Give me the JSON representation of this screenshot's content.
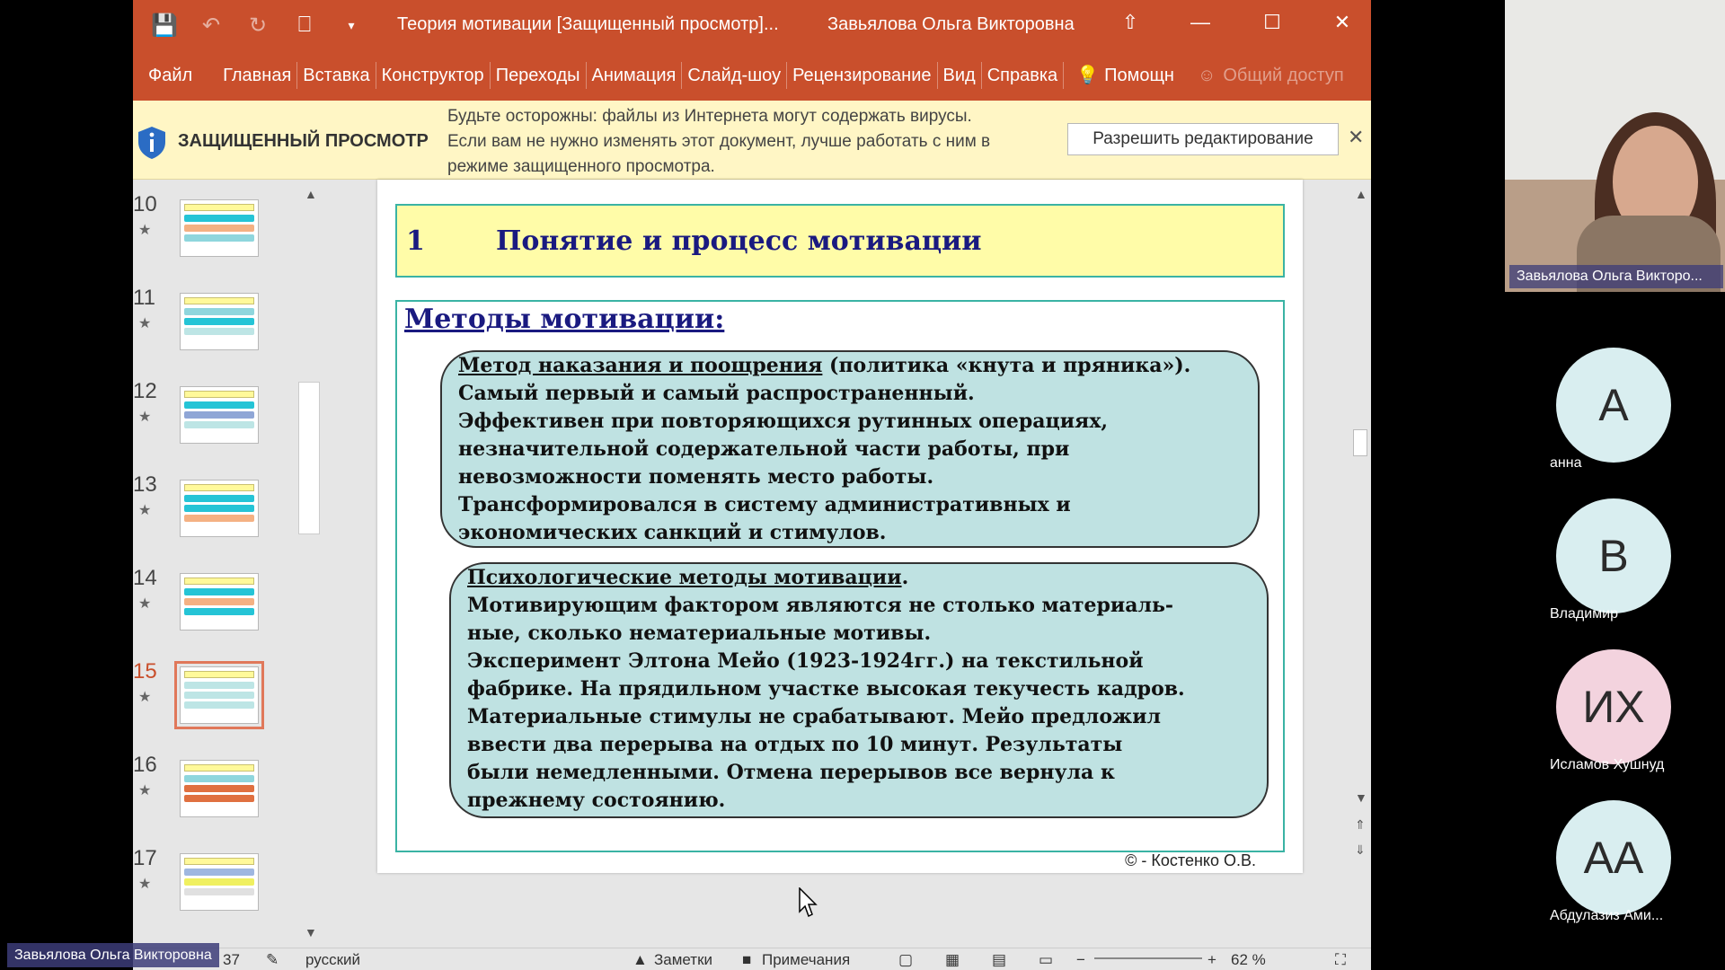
{
  "window": {
    "doc_title": "Теория мотивации [Защищенный просмотр]...",
    "user_name": "Завьялова Ольга Викторовна"
  },
  "ribbon": {
    "tabs": [
      "Главная",
      "Вставка",
      "Конструктор",
      "Переходы",
      "Анимация",
      "Слайд-шоу",
      "Рецензирование",
      "Вид",
      "Справка"
    ],
    "file": "Файл",
    "help": "Помощн",
    "share": "Общий доступ"
  },
  "protected_view": {
    "title": "ЗАЩИЩЕННЫЙ ПРОСМОТР",
    "message_lines": [
      "Будьте осторожны: файлы из Интернета могут содержать вирусы.",
      "Если вам не нужно изменять этот документ, лучше работать с ним в",
      "режиме защищенного просмотра."
    ],
    "enable_button": "Разрешить редактирование"
  },
  "thumbnails": [
    {
      "num": "10",
      "colors": [
        "#25c4d6",
        "#f4b183",
        "#8fd6dd"
      ]
    },
    {
      "num": "11",
      "colors": [
        "#8fd6dd",
        "#25c4d6",
        "#bde5e5"
      ]
    },
    {
      "num": "12",
      "colors": [
        "#25c4d6",
        "#8fa6d6",
        "#bde5e5"
      ]
    },
    {
      "num": "13",
      "colors": [
        "#25c4d6",
        "#25c4d6",
        "#f4b183"
      ]
    },
    {
      "num": "14",
      "colors": [
        "#25c4d6",
        "#f4b183",
        "#25c4d6"
      ]
    },
    {
      "num": "15",
      "colors": [
        "#bde5e5",
        "#bde5e5",
        "#bde5e5"
      ]
    },
    {
      "num": "16",
      "colors": [
        "#8fd6dd",
        "#e07040",
        "#e07040"
      ]
    },
    {
      "num": "17",
      "colors": [
        "#9fb7e0",
        "#f0f060",
        "#e0e0e0"
      ]
    }
  ],
  "slide": {
    "number": "1",
    "title": "Понятие и процесс мотивации",
    "heading": "Методы мотивации:",
    "bubble1": {
      "lead": "Метод наказания и поощрения",
      "lead_rest": " (политика «кнута и пряника»).",
      "lines": [
        "Самый первый и самый распространенный.",
        "Эффективен при повторяющихся рутинных операциях,",
        "незначительной содержательной части работы, при",
        "невозможности поменять место работы.",
        "Трансформировался в систему административных и",
        "экономических санкций и стимулов."
      ]
    },
    "bubble2": {
      "lead": "Психологические методы мотивации",
      "lead_rest": ".",
      "lines": [
        "Мотивирующим фактором являются не столько материаль-",
        "ные, сколько нематериальные мотивы.",
        "Эксперимент Элтона Мейо (1923-1924гг.) на текстильной",
        "фабрике. На прядильном участке высокая текучесть кадров.",
        "Материальные стимулы не срабатывают. Мейо предложил",
        "ввести два перерыва на отдых по 10 минут. Результаты",
        "были немедленными. Отмена перерывов все вернула к",
        "прежнему состоянию."
      ]
    },
    "copyright": "© - Костенко О.В."
  },
  "status_bar": {
    "slide_info": "37",
    "language": "русский",
    "notes": "Заметки",
    "comments": "Примечания",
    "zoom": "62 %"
  },
  "video": {
    "name": "Завьялова Ольга Викторо..."
  },
  "participants": [
    {
      "initials": "А",
      "name": "анна",
      "color": "#d9eef0"
    },
    {
      "initials": "В",
      "name": "Владимир",
      "color": "#d9eef0"
    },
    {
      "initials": "ИХ",
      "name": "Исламов Хушнуд",
      "color": "#f3d3de"
    },
    {
      "initials": "АА",
      "name": "Абдулазиз Ами...",
      "color": "#d9eef0"
    }
  ],
  "bottom_label": "Завьялова Ольга Викторовна"
}
